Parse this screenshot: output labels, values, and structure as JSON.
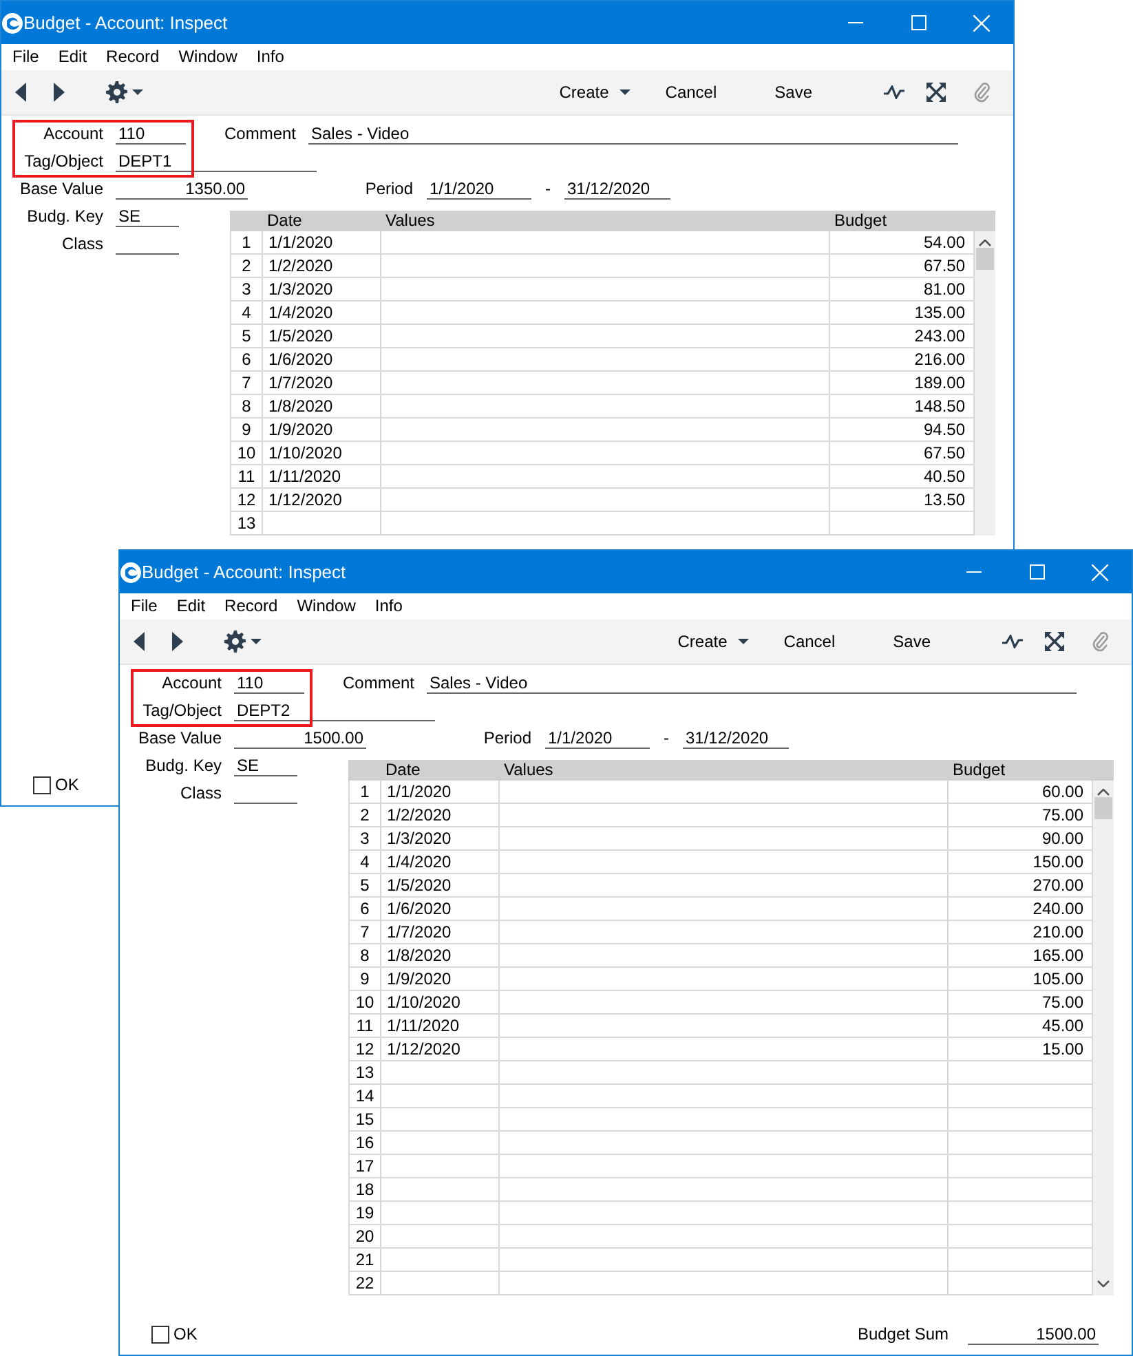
{
  "windows": [
    {
      "title": "Budget - Account: Inspect",
      "menu": [
        "File",
        "Edit",
        "Record",
        "Window",
        "Info"
      ],
      "toolbar": {
        "create": "Create",
        "cancel": "Cancel",
        "save": "Save"
      },
      "highlighted": true,
      "form": {
        "account": {
          "label": "Account",
          "value": "110"
        },
        "comment": {
          "label": "Comment",
          "value": "Sales - Video"
        },
        "tag_object": {
          "label": "Tag/Object",
          "value": "DEPT1"
        },
        "base_value": {
          "label": "Base Value",
          "value": "1350.00"
        },
        "period": {
          "label": "Period",
          "from": "1/1/2020",
          "separator": "-",
          "to": "31/12/2020"
        },
        "budg_key": {
          "label": "Budg. Key",
          "value": "SE"
        },
        "class": {
          "label": "Class"
        }
      },
      "table": {
        "columns": [
          "Date",
          "Values",
          "Budget"
        ],
        "rows": [
          {
            "number": "1",
            "date": "1/1/2020",
            "budget": "54.00"
          },
          {
            "number": "2",
            "date": "1/2/2020",
            "budget": "67.50"
          },
          {
            "number": "3",
            "date": "1/3/2020",
            "budget": "81.00"
          },
          {
            "number": "4",
            "date": "1/4/2020",
            "budget": "135.00"
          },
          {
            "number": "5",
            "date": "1/5/2020",
            "budget": "243.00"
          },
          {
            "number": "6",
            "date": "1/6/2020",
            "budget": "216.00"
          },
          {
            "number": "7",
            "date": "1/7/2020",
            "budget": "189.00"
          },
          {
            "number": "8",
            "date": "1/8/2020",
            "budget": "148.50"
          },
          {
            "number": "9",
            "date": "1/9/2020",
            "budget": "94.50"
          },
          {
            "number": "10",
            "date": "1/10/2020",
            "budget": "67.50"
          },
          {
            "number": "11",
            "date": "1/11/2020",
            "budget": "40.50"
          },
          {
            "number": "12",
            "date": "1/12/2020",
            "budget": "13.50"
          },
          {
            "number": "13"
          }
        ]
      },
      "footer": {
        "ok": {
          "label": "OK",
          "checked": false
        }
      }
    },
    {
      "title": "Budget - Account: Inspect",
      "menu": [
        "File",
        "Edit",
        "Record",
        "Window",
        "Info"
      ],
      "toolbar": {
        "create": "Create",
        "cancel": "Cancel",
        "save": "Save"
      },
      "highlighted": true,
      "form": {
        "account": {
          "label": "Account",
          "value": "110"
        },
        "comment": {
          "label": "Comment",
          "value": "Sales - Video"
        },
        "tag_object": {
          "label": "Tag/Object",
          "value": "DEPT2"
        },
        "base_value": {
          "label": "Base Value",
          "value": "1500.00"
        },
        "period": {
          "label": "Period",
          "from": "1/1/2020",
          "separator": "-",
          "to": "31/12/2020"
        },
        "budg_key": {
          "label": "Budg. Key",
          "value": "SE"
        },
        "class": {
          "label": "Class"
        }
      },
      "table": {
        "columns": [
          "Date",
          "Values",
          "Budget"
        ],
        "rows": [
          {
            "number": "1",
            "date": "1/1/2020",
            "budget": "60.00"
          },
          {
            "number": "2",
            "date": "1/2/2020",
            "budget": "75.00"
          },
          {
            "number": "3",
            "date": "1/3/2020",
            "budget": "90.00"
          },
          {
            "number": "4",
            "date": "1/4/2020",
            "budget": "150.00"
          },
          {
            "number": "5",
            "date": "1/5/2020",
            "budget": "270.00"
          },
          {
            "number": "6",
            "date": "1/6/2020",
            "budget": "240.00"
          },
          {
            "number": "7",
            "date": "1/7/2020",
            "budget": "210.00"
          },
          {
            "number": "8",
            "date": "1/8/2020",
            "budget": "165.00"
          },
          {
            "number": "9",
            "date": "1/9/2020",
            "budget": "105.00"
          },
          {
            "number": "10",
            "date": "1/10/2020",
            "budget": "75.00"
          },
          {
            "number": "11",
            "date": "1/11/2020",
            "budget": "45.00"
          },
          {
            "number": "12",
            "date": "1/12/2020",
            "budget": "15.00"
          },
          {
            "number": "13"
          },
          {
            "number": "14"
          },
          {
            "number": "15"
          },
          {
            "number": "16"
          },
          {
            "number": "17"
          },
          {
            "number": "18"
          },
          {
            "number": "19"
          },
          {
            "number": "20"
          },
          {
            "number": "21"
          },
          {
            "number": "22"
          }
        ]
      },
      "footer": {
        "ok": {
          "label": "OK",
          "checked": false
        },
        "budget_sum": {
          "label": "Budget Sum",
          "value": "1500.00"
        }
      }
    }
  ]
}
